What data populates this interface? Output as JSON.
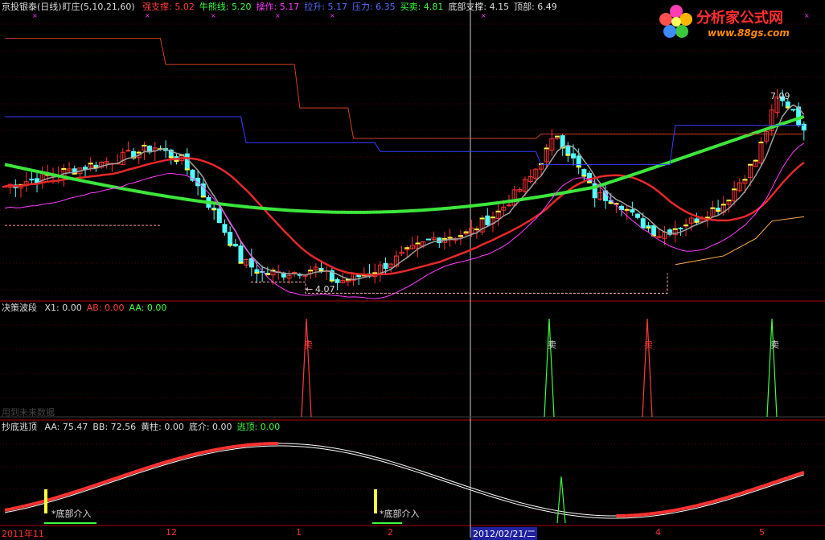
{
  "panel1": {
    "title": "京投银泰(日线)",
    "indicator": "盯庄(5,10,21,60)",
    "params": [
      {
        "label": "强支撑:",
        "value": "5.02",
        "color": "#ff3c3c"
      },
      {
        "label": "牛熊线:",
        "value": "5.20",
        "color": "#3cff3c"
      },
      {
        "label": "操作:",
        "value": "5.17",
        "color": "#ff3cff"
      },
      {
        "label": "拉升:",
        "value": "5.17",
        "color": "#5b6bff"
      },
      {
        "label": "压力:",
        "value": "6.35",
        "color": "#5b6bff"
      },
      {
        "label": "买卖:",
        "value": "4.81",
        "color": "#3cff3c"
      },
      {
        "label": "底部支撑:",
        "value": "4.15",
        "color": "#dddddd"
      },
      {
        "label": "顶部:",
        "value": "6.49",
        "color": "#dddddd"
      }
    ],
    "high_label": "7.09",
    "low_label": "4.07"
  },
  "panel2": {
    "title": "决策波段",
    "params": [
      {
        "label": "X1:",
        "value": "0.00",
        "color": "#dddddd"
      },
      {
        "label": "AB:",
        "value": "0.00",
        "color": "#ff3c3c"
      },
      {
        "label": "AA:",
        "value": "0.00",
        "color": "#3cff3c"
      }
    ],
    "future_note": "用到未来数据",
    "sell_label": "卖"
  },
  "panel3": {
    "title": "抄底逃顶",
    "params": [
      {
        "label": "AA:",
        "value": "75.47",
        "color": "#dddddd"
      },
      {
        "label": "BB:",
        "value": "72.56",
        "color": "#dddddd"
      },
      {
        "label": "黄柱:",
        "value": "0.00",
        "color": "#dddddd"
      },
      {
        "label": "底介:",
        "value": "0.00",
        "color": "#dddddd"
      },
      {
        "label": "逃顶:",
        "value": "0.00",
        "color": "#3cff3c"
      }
    ],
    "bottom_label": "*底部介入"
  },
  "x_axis": {
    "labels": [
      "2011年11",
      "12",
      "1",
      "2",
      "2012/02/21/二",
      "4",
      "5"
    ]
  },
  "logo": {
    "name": "分析家公式网",
    "url": "www.88gs.com"
  },
  "colors": {
    "up": "#ff3232",
    "down": "#54ffff",
    "ma_green": "#3ce63c",
    "ma_red": "#e62828",
    "ma_gray": "#a0a0a0",
    "magenta": "#ff3cff",
    "blue": "#3c3cff",
    "yellow": "#ffff3c"
  },
  "chart_data": [
    {
      "type": "candlestick",
      "title": "京投银泰(日线)",
      "ylim": [
        4.0,
        7.2
      ],
      "series": [
        {
          "name": "强支撑",
          "current": 5.02
        },
        {
          "name": "牛熊线",
          "current": 5.2
        },
        {
          "name": "操作",
          "current": 5.17
        },
        {
          "name": "拉升",
          "current": 5.17
        },
        {
          "name": "压力",
          "current": 6.35
        },
        {
          "name": "买卖",
          "current": 4.81
        },
        {
          "name": "底部支撑",
          "current": 4.15
        },
        {
          "name": "顶部",
          "current": 6.49
        }
      ],
      "annotations": [
        {
          "text": "7.09",
          "value": 7.09
        },
        {
          "text": "4.07",
          "value": 4.07
        }
      ]
    },
    {
      "type": "line",
      "title": "决策波段",
      "series": [
        {
          "name": "X1",
          "current": 0.0
        },
        {
          "name": "AB",
          "current": 0.0
        },
        {
          "name": "AA",
          "current": 0.0
        }
      ],
      "signals": [
        "卖",
        "卖",
        "卖",
        "卖"
      ]
    },
    {
      "type": "line",
      "title": "抄底逃顶",
      "series": [
        {
          "name": "AA",
          "current": 75.47
        },
        {
          "name": "BB",
          "current": 72.56
        },
        {
          "name": "黄柱",
          "current": 0.0
        },
        {
          "name": "底介",
          "current": 0.0
        },
        {
          "name": "逃顶",
          "current": 0.0
        }
      ]
    }
  ]
}
